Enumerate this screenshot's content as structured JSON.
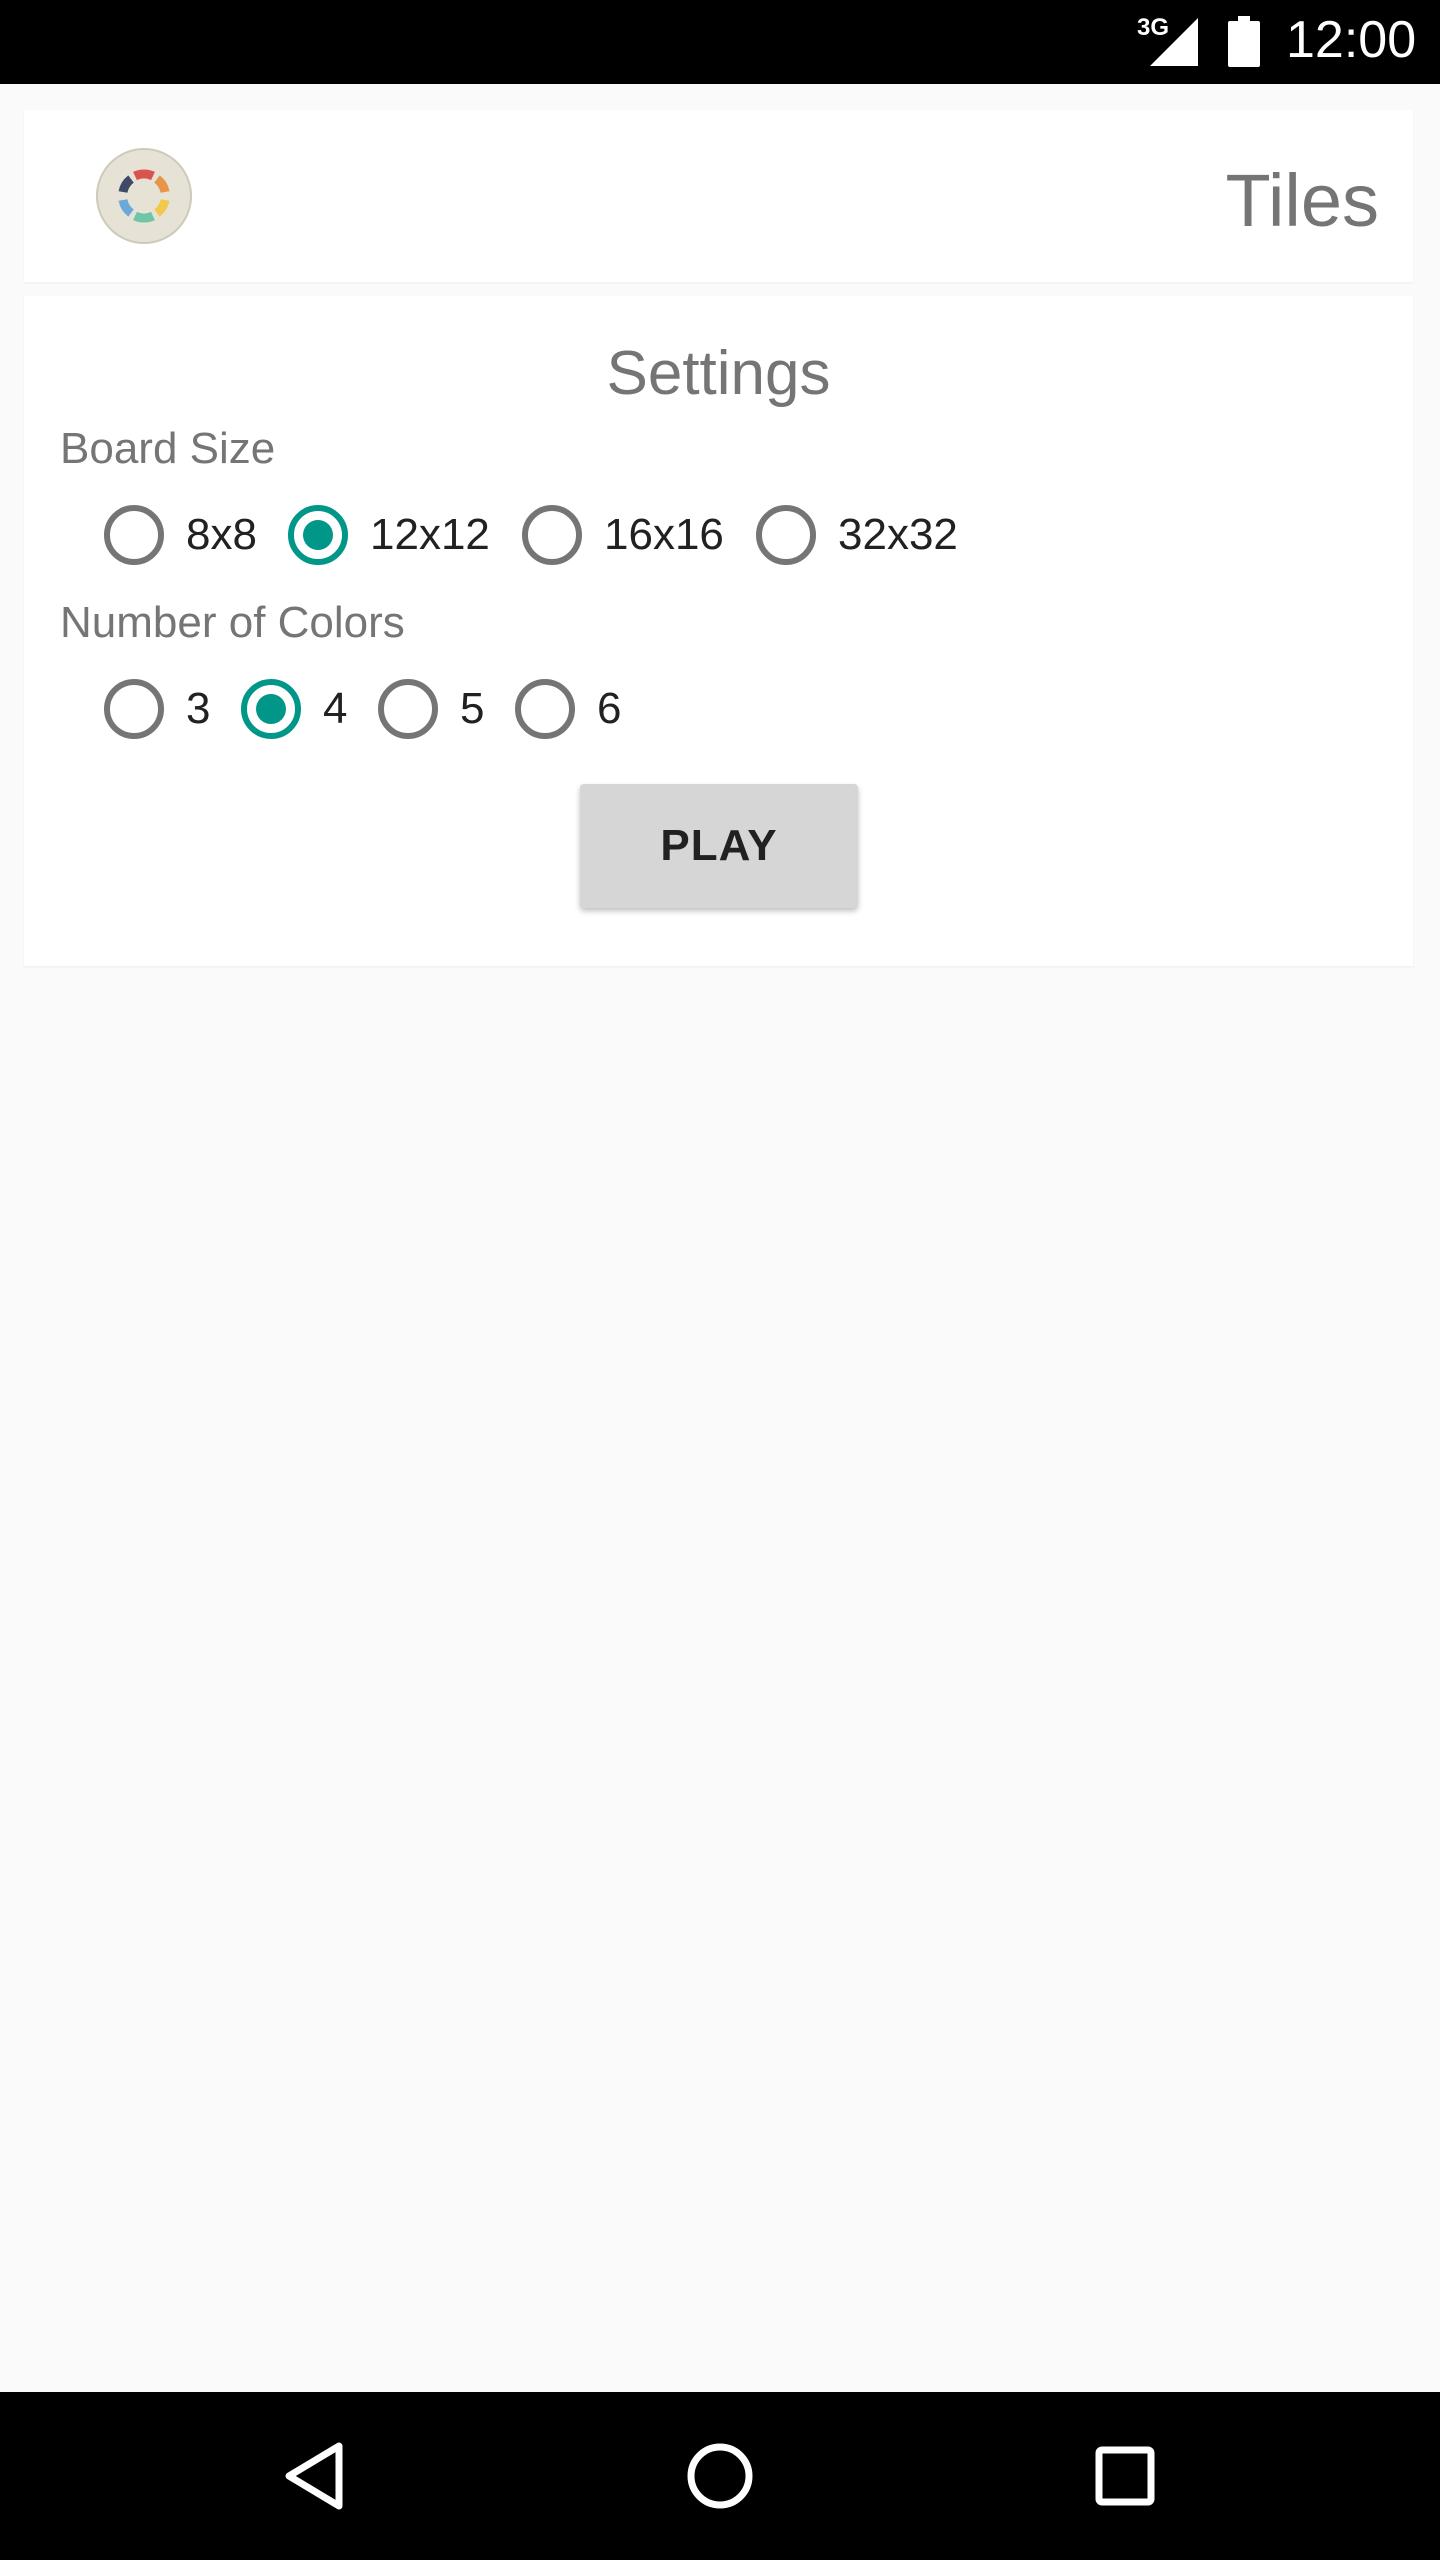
{
  "status_bar": {
    "network": "3G",
    "time": "12:00",
    "icons": [
      "signal-icon",
      "battery-icon"
    ]
  },
  "header": {
    "logo": "tiles-color-wheel-logo",
    "title": "Tiles"
  },
  "settings": {
    "title": "Settings",
    "board_size": {
      "label": "Board Size",
      "options": [
        "8x8",
        "12x12",
        "16x16",
        "32x32"
      ],
      "selected": "12x12"
    },
    "colors": {
      "label": "Number of Colors",
      "options": [
        "3",
        "4",
        "5",
        "6"
      ],
      "selected": "4"
    },
    "play_label": "PLAY"
  },
  "nav_bar": {
    "icons": [
      "back-icon",
      "home-icon",
      "recents-icon"
    ]
  },
  "theme": {
    "accent": "#009688",
    "muted_text": "#757575",
    "background": "#fafafa"
  }
}
